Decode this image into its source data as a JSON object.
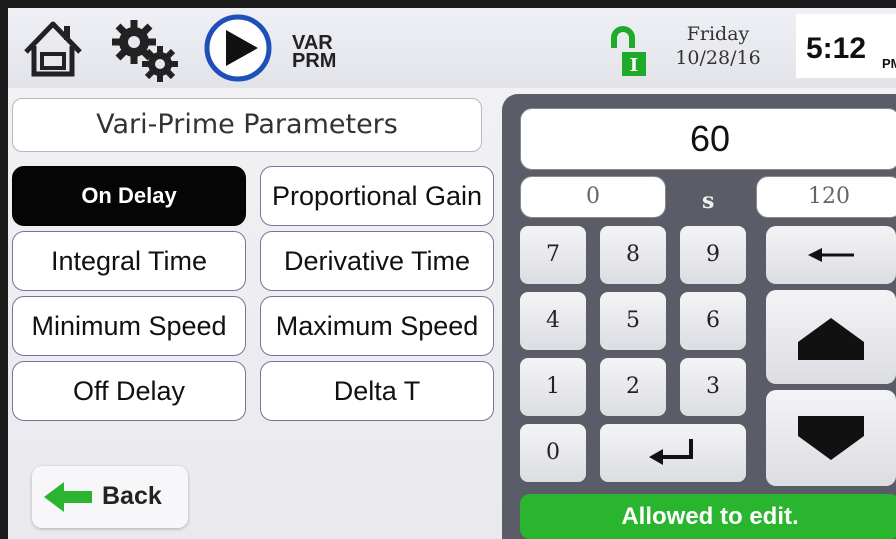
{
  "header": {
    "mode_line1": "VAR",
    "mode_line2": "PRM",
    "day": "Friday",
    "date": "10/28/16",
    "time": "5:12",
    "ampm": "PM"
  },
  "left_panel": {
    "title": "Vari-Prime Parameters",
    "buttons": [
      {
        "label": "On Delay"
      },
      {
        "label": "Proportional Gain"
      },
      {
        "label": "Integral Time"
      },
      {
        "label": "Derivative Time"
      },
      {
        "label": "Minimum Speed"
      },
      {
        "label": "Maximum Speed"
      },
      {
        "label": "Off Delay"
      },
      {
        "label": "Delta T"
      }
    ],
    "back_label": "Back"
  },
  "keypad": {
    "value": "60",
    "min": "0",
    "unit": "s",
    "max": "120",
    "keys": [
      "7",
      "8",
      "9",
      "4",
      "5",
      "6",
      "1",
      "2",
      "3",
      "0"
    ],
    "status": "Allowed to edit."
  },
  "colors": {
    "status_green": "#2ab52e",
    "play_blue": "#1f4fb8",
    "lock_green": "#1faa2a"
  }
}
